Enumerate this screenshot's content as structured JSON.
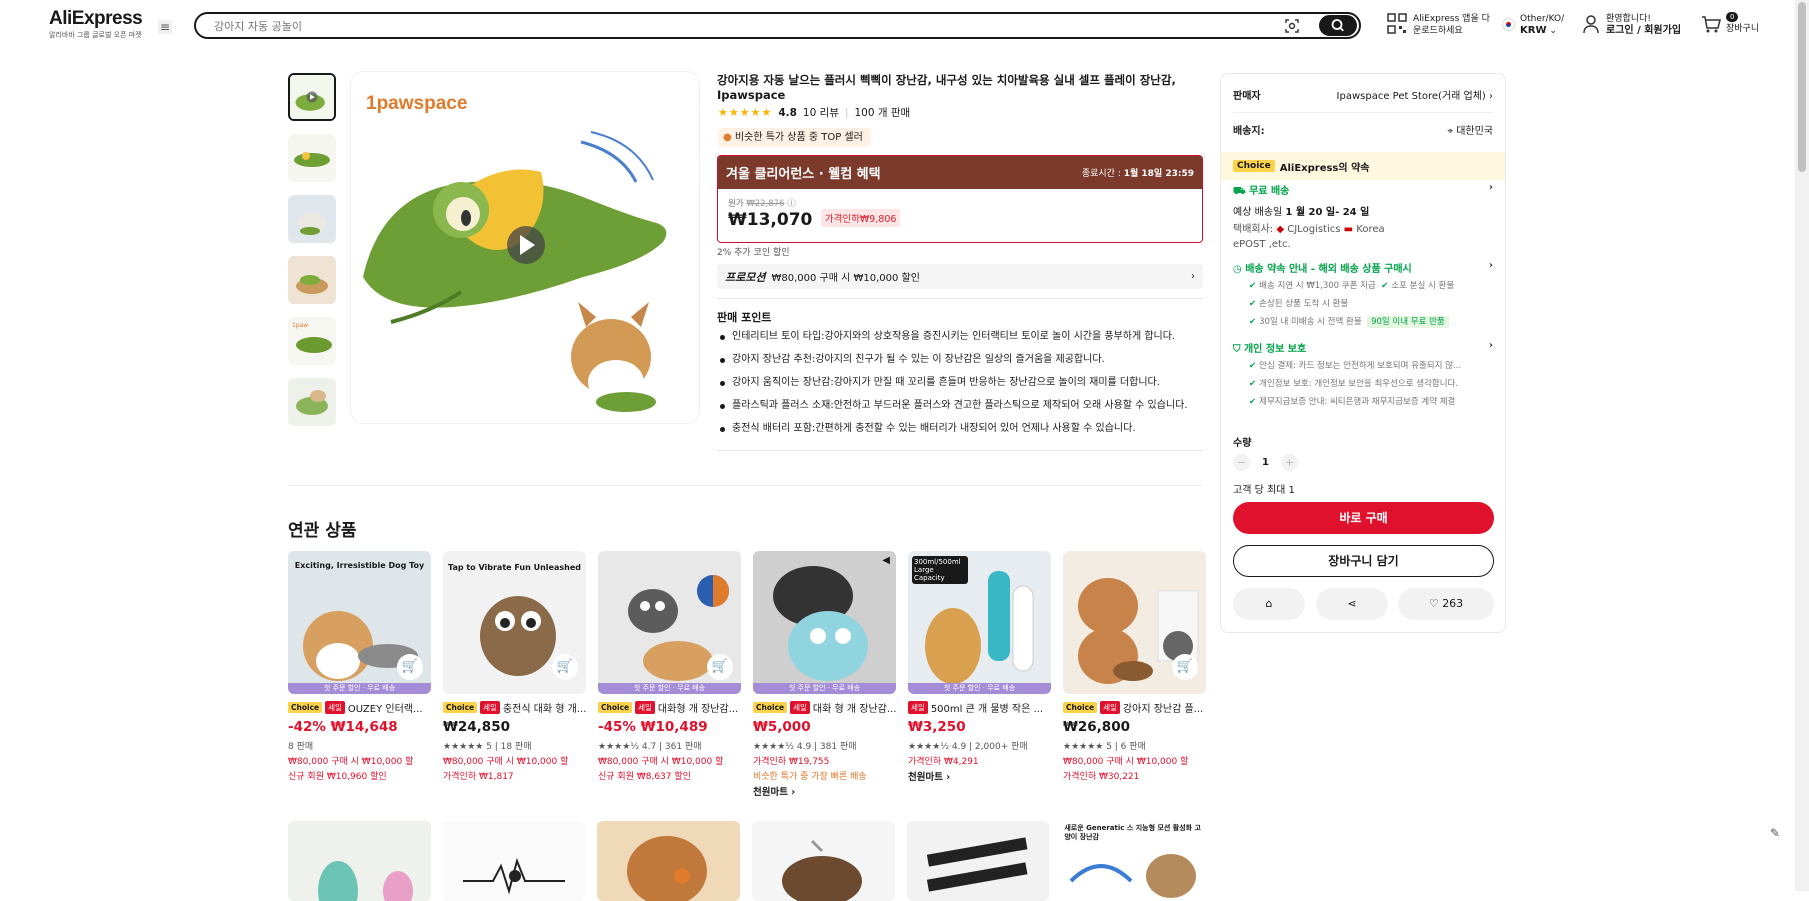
{
  "header": {
    "logo": "AliExpress",
    "logo_sub": "알리바바 그룹 글로벌 오픈 마켓",
    "search_placeholder": "강아지 자동 공놀이",
    "app_line1": "AliExpress 앱을 다",
    "app_line2": "운로드하세요",
    "region_line1": "Other/KO/",
    "region_line2": "KRW",
    "login_line1": "환영합니다!",
    "login_line2": "로그인 / 회원가입",
    "cart_count": "0",
    "cart_label": "장바구니"
  },
  "product": {
    "brand_overlay": "1pawspace",
    "title": "강아지용 자동 날으는 플러시 삑삑이 장난감, 내구성 있는 치아발육용 실내 셀프 플레이 장난감, Ipawspace",
    "rating": "4.8",
    "reviews": "10 리뷰",
    "sold": "100 개 판매",
    "top_badge": "비슷한 특가 상품 중 TOP 셀러",
    "deal_title": "겨울 클리어런스 · 웰컴 혜택",
    "deal_end_label": "종료시간 :",
    "deal_end": "1월 18일 23:59",
    "orig_label": "원가",
    "orig_price": "₩22,876",
    "price": "₩13,070",
    "price_drop": "가격인하₩9,806",
    "coin": "2% 추가 코인 할인",
    "promo_label": "프로모션",
    "promo_text": "₩80,000 구매 시 ₩10,000 할인",
    "selling_points_title": "판매 포인트",
    "selling_points": [
      "인테리티브 토이 타입:강아지와의 상호작용을 증진시키는 인터랙티브 토이로 놀이 시간을 풍부하게 합니다.",
      "강아지 장난감 추천:강아지의 친구가 될 수 있는 이 장난감은 일상의 즐거움을 제공합니다.",
      "강아지 움직이는 장난감:강아지가 만질 때 꼬리를 흔들며 반응하는 장난감으로 놀이의 재미를 더합니다.",
      "플라스틱과 플러스 소재:안전하고 부드러운 플러스와 견고한 플라스틱으로 제작되어 오래 사용할 수 있습니다.",
      "충전식 배터리 포함:간편하게 충전할 수 있는 배터리가 내장되어 있어 언제나 사용할 수 있습니다."
    ]
  },
  "side": {
    "seller_label": "판매자",
    "seller_name": "Ipawspace Pet Store(거래 업체)",
    "ship_label": "배송지:",
    "ship_country": "대한민국",
    "choice_badge": "Choice",
    "choice_text": "AliExpress의 약속",
    "free_ship": "무료 배송",
    "eta_prefix": "예상 배송일",
    "eta_dates": "1 월 20 일- 24 일",
    "courier_label": "택배회사:",
    "courier_1": "CJLogistics",
    "courier_2": "Korea",
    "courier_3": "ePOST ,etc.",
    "promise_title": "배송 약속 안내 - 해외 배송 상품 구매시",
    "promise_items": [
      "배송 지연 시 ₩1,300 쿠폰 지급",
      "소포 분실 시 환불",
      "손상된 상품 도착 시 환불",
      "30일 내 미배송 시 전액 환불"
    ],
    "promise_badge": "90일 이내 무료 반품",
    "privacy_title": "개인 정보 보호",
    "privacy_items": [
      "안심 결제: 카드 정보는 안전하게 보호되며 유출되지 않...",
      "개인정보 보호: 개인정보 보안을 최우선으로 생각합니다.",
      "제무지급보증 안내: 씨티은행과 채무지급보증 계약 체결"
    ],
    "qty_label": "수량",
    "qty_value": "1",
    "qty_limit": "고객 당 최대 1",
    "buy_now": "바로 구매",
    "add_cart": "장바구니 담기",
    "wish_count": "263"
  },
  "related": {
    "title": "연관 상품",
    "items": [
      {
        "name": "OUZEY 인터랙...",
        "price": "-42% ₩14,648",
        "meta": "8 판매",
        "line1": "₩80,000 구매 시 ₩10,000 할",
        "line2": "신규 회원 ₩10,960 할인",
        "tag": "첫 주문 할인 · 무료 배송",
        "img_text": "Exciting, Irresistible Dog Toy"
      },
      {
        "name": "충전식 대화 형 개...",
        "price": "₩24,850",
        "meta": "★★★★★ 5 | 18 판매",
        "line1": "₩80,000 구매 시 ₩10,000 할",
        "line2": "가격인하 ₩1,817",
        "tag": "첫 주문 할인 · 무료 배송",
        "img_text": "Tap to Vibrate Fun Unleashed"
      },
      {
        "name": "대화형 개 장난감...",
        "price": "-45% ₩10,489",
        "meta": "★★★★½ 4.7 | 361 판매",
        "line1": "₩80,000 구매 시 ₩10,000 할",
        "line2": "신규 회원 ₩8,637 할인",
        "tag": "첫 주문 할인 · 무료 배송",
        "img_text": ""
      },
      {
        "name": "대화 형 개 장난감...",
        "price": "₩5,000",
        "meta": "★★★★½ 4.9 | 381 판매",
        "line1": "가격인하 ₩19,755",
        "line2": "비슷한 특가 중 가장 빠른 배송",
        "extra": "천원마트 ›",
        "tag": "첫 주문 할인 · 무료 배송",
        "img_text": ""
      },
      {
        "name": "500ml 큰 개 물병 작은 ...",
        "price": "₩3,250",
        "meta": "★★★★½ 4.9 | 2,000+ 판매",
        "line1": "가격인하 ₩4,291",
        "line2": "천원마트 ›",
        "tag": "첫 주문 할인 · 무료 배송",
        "img_text": "300ml/500ml Large Capacity"
      },
      {
        "name": "강아지 장난감 플...",
        "price": "₩26,800",
        "meta": "★★★★★ 5 | 6 판매",
        "line1": "₩80,000 구매 시 ₩10,000 할",
        "line2": "가격인하 ₩30,221",
        "tag": "",
        "img_text": ""
      }
    ],
    "row2_text": "새로운 Generatic 스 지능형 모션 활성화 고양이 장난감"
  }
}
